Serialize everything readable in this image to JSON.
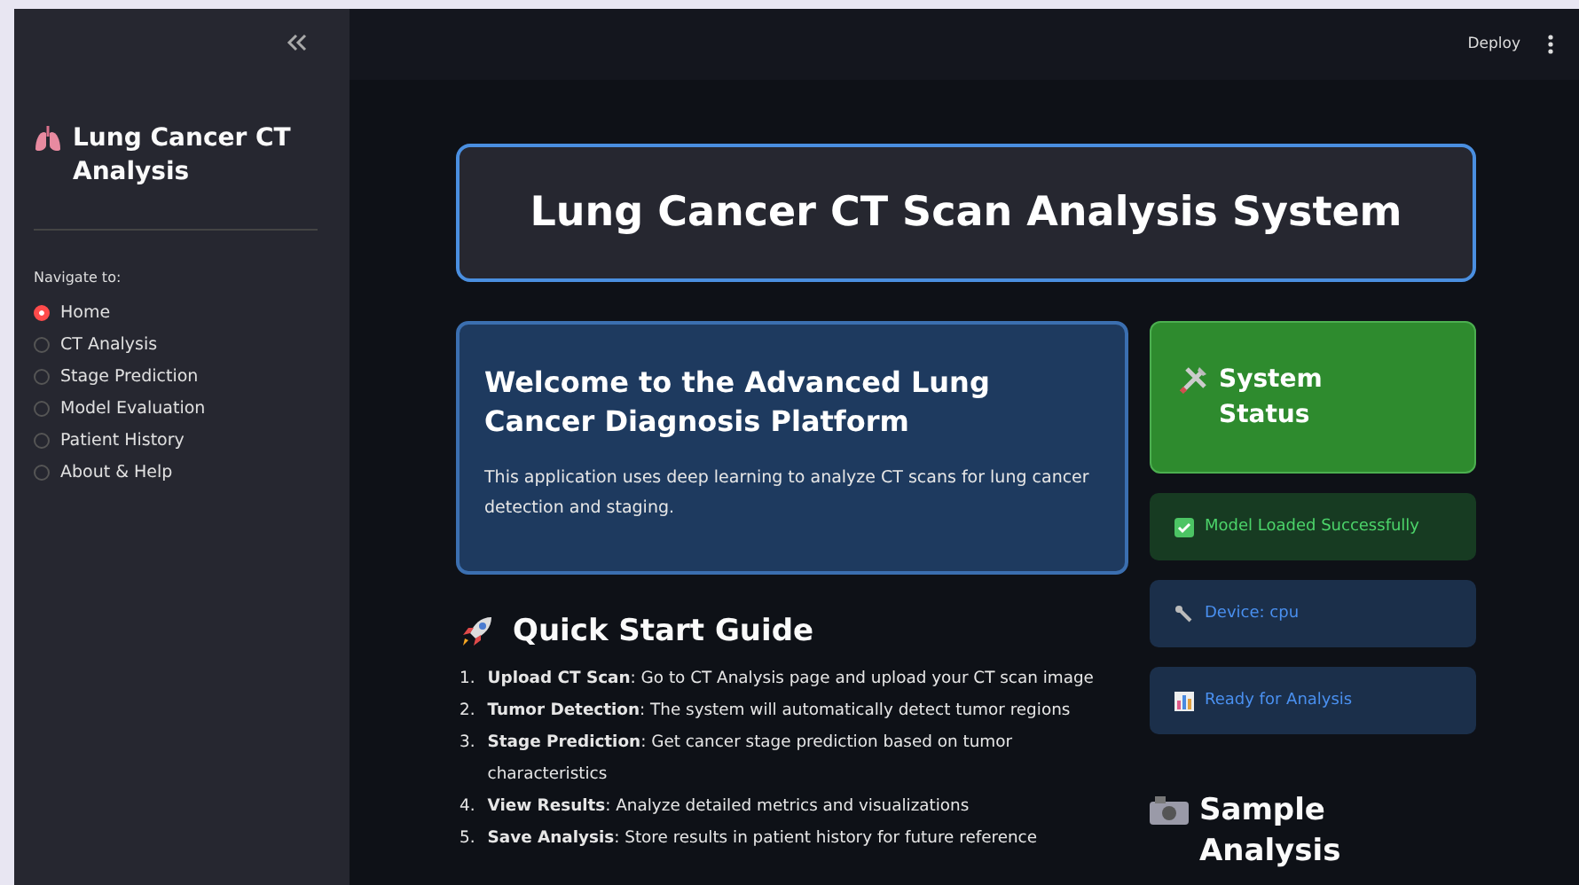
{
  "sidebar": {
    "title": "Lung Cancer CT Analysis",
    "nav_label": "Navigate to:",
    "items": [
      {
        "label": "Home",
        "selected": true
      },
      {
        "label": "CT Analysis",
        "selected": false
      },
      {
        "label": "Stage Prediction",
        "selected": false
      },
      {
        "label": "Model Evaluation",
        "selected": false
      },
      {
        "label": "Patient History",
        "selected": false
      },
      {
        "label": "About & Help",
        "selected": false
      }
    ]
  },
  "header": {
    "deploy": "Deploy"
  },
  "main": {
    "title": "Lung Cancer CT Scan Analysis System",
    "welcome": {
      "heading": "Welcome to the Advanced Lung Cancer Diagnosis Platform",
      "text": "This application uses deep learning to analyze CT scans for lung cancer detection and staging."
    },
    "guide": {
      "heading": "Quick Start Guide",
      "steps": [
        {
          "number": "1.",
          "text": "**Upload CT Scan**: Go to CT Analysis page and upload your CT scan image"
        },
        {
          "number": "2.",
          "text": "**Tumor Detection**: The system will automatically detect tumor regions"
        },
        {
          "number": "3.",
          "text": "**Stage Prediction**: Get cancer stage prediction based on tumor characteristics"
        },
        {
          "number": "4.",
          "text": "**View Results**: Analyze detailed metrics and visualizations"
        },
        {
          "number": "5.",
          "text": "**Save Analysis**: Store results in patient history for future reference"
        }
      ]
    },
    "status": {
      "heading": "System Status",
      "alerts": [
        {
          "kind": "success",
          "text": "Model Loaded Successfully"
        },
        {
          "kind": "device",
          "text": "Device: cpu"
        },
        {
          "kind": "ready",
          "text": "Ready for Analysis"
        }
      ]
    },
    "sample": {
      "heading": "Sample Analysis"
    }
  }
}
